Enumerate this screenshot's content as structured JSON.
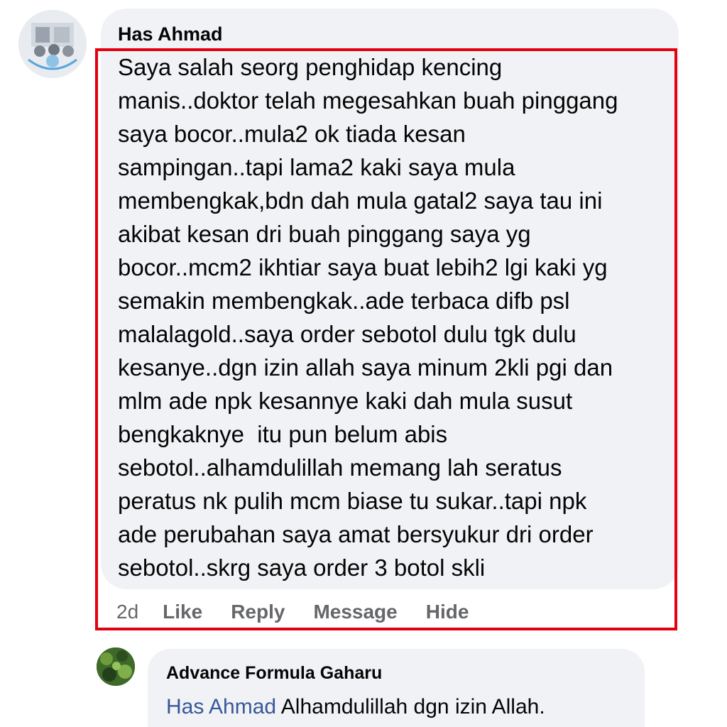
{
  "comment": {
    "author": "Has Ahmad",
    "lines": [
      "Saya salah seorg penghidap kencing",
      "manis..doktor telah megesahkan buah pinggang",
      "saya bocor..mula2 ok tiada kesan",
      "sampingan..tapi lama2 kaki saya mula",
      "membengkak,bdn dah mula gatal2 saya tau ini",
      "akibat kesan dri buah pinggang saya yg",
      "bocor..mcm2 ikhtiar saya buat lebih2 lgi kaki yg",
      "semakin membengkak..ade terbaca difb psl",
      "malalagold..saya order sebotol dulu tgk dulu",
      "kesanye..dgn izin allah saya minum 2kli pgi dan",
      "mlm ade npk kesannye kaki dah mula susut",
      "bengkaknye  itu pun belum abis",
      "sebotol..alhamdulillah memang lah seratus",
      "peratus nk pulih mcm biase tu sukar..tapi npk",
      "ade perubahan saya amat bersyukur dri order",
      "sebotol..skrg saya order 3 botol skli"
    ],
    "age": "2d",
    "actions": {
      "like": "Like",
      "reply": "Reply",
      "message": "Message",
      "hide": "Hide"
    }
  },
  "reply": {
    "author": "Advance Formula Gaharu",
    "mention": "Has Ahmad",
    "text": "Alhamdulillah dgn izin Allah."
  },
  "colors": {
    "highlight": "#e3000f",
    "bubble": "#f0f2f5",
    "action_text": "#65676b",
    "mention": "#385898"
  }
}
